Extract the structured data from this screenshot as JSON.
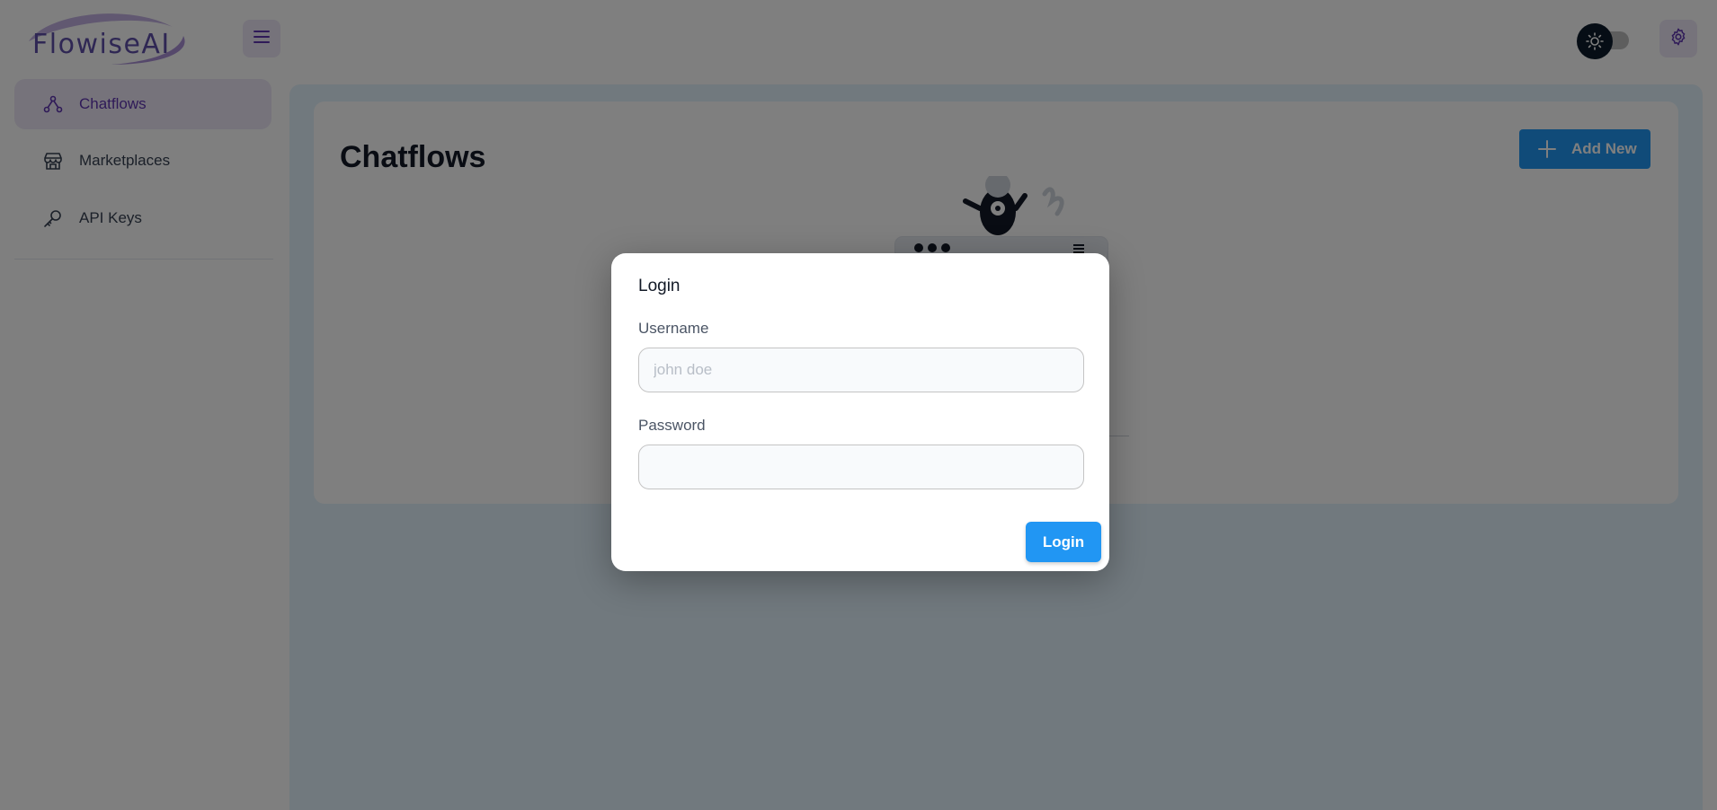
{
  "header": {
    "logo_text": "FlowiseAI",
    "menu_icon": "hamburger-menu-icon",
    "theme_icon": "sun-icon",
    "settings_icon": "gear-icon"
  },
  "sidebar": {
    "items": [
      {
        "label": "Chatflows",
        "icon": "chatflow-icon",
        "active": true
      },
      {
        "label": "Marketplaces",
        "icon": "store-icon",
        "active": false
      },
      {
        "label": "API Keys",
        "icon": "key-icon",
        "active": false
      }
    ]
  },
  "main": {
    "title": "Chatflows",
    "add_new_label": "Add New"
  },
  "dialog": {
    "title": "Login",
    "username_label": "Username",
    "username_placeholder": "john doe",
    "username_value": "",
    "password_label": "Password",
    "password_value": "",
    "login_label": "Login"
  },
  "colors": {
    "primary": "#2196f3",
    "secondary": "#5e35b1",
    "secondary_light": "#ede7f6",
    "main_bg": "#e3f2fd"
  }
}
